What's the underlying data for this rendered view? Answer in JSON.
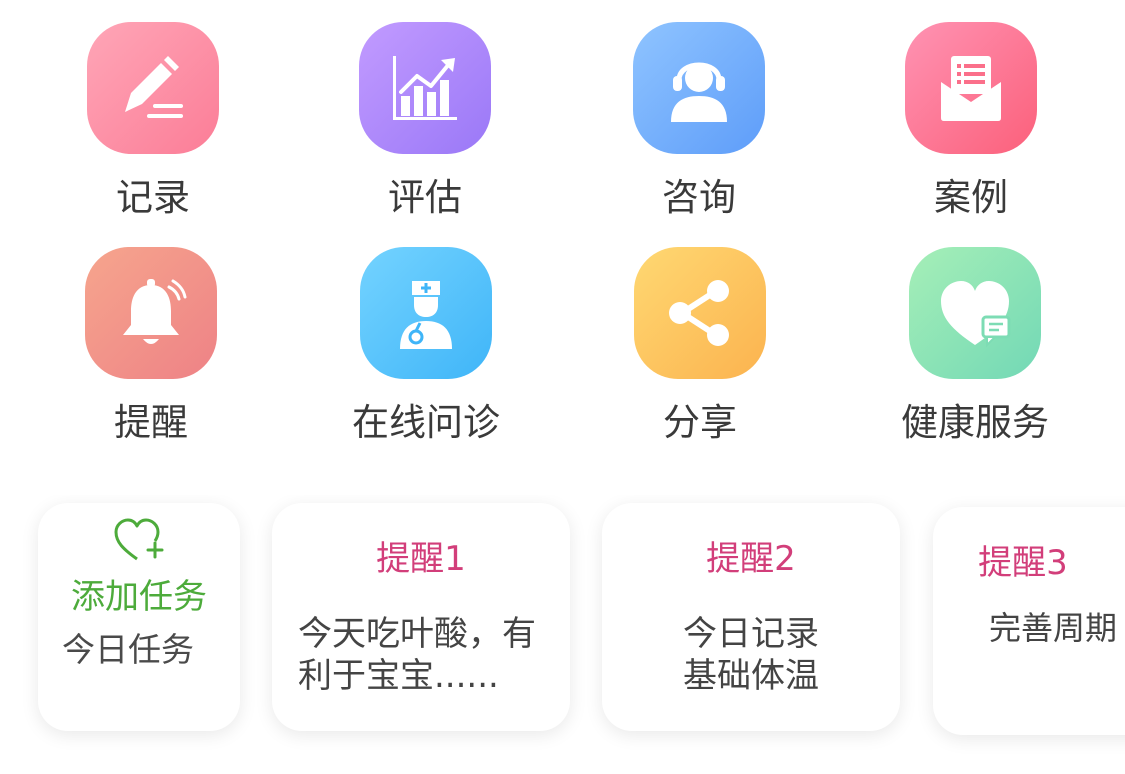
{
  "colors": {
    "label": "#3a3a3a",
    "reminder_title": "#d23e7a",
    "add_task": "#4dab3b",
    "card_text": "#444444"
  },
  "features": [
    {
      "label": "记录",
      "icon": "pencil-icon"
    },
    {
      "label": "评估",
      "icon": "bar-chart-icon"
    },
    {
      "label": "咨询",
      "icon": "headset-agent-icon"
    },
    {
      "label": "案例",
      "icon": "mail-envelope-icon"
    },
    {
      "label": "提醒",
      "icon": "bell-icon"
    },
    {
      "label": "在线问诊",
      "icon": "doctor-icon"
    },
    {
      "label": "分享",
      "icon": "share-icon"
    },
    {
      "label": "健康服务",
      "icon": "heart-chat-icon"
    }
  ],
  "tasks": {
    "add_card": {
      "icon": "heart-plus-icon",
      "title": "添加任务",
      "subtitle": "今日任务"
    },
    "reminders": [
      {
        "title": "提醒1",
        "body": "今天吃叶酸，有\n利于宝宝......"
      },
      {
        "title": "提醒2",
        "body": "今日记录\n基础体温"
      },
      {
        "title": "提醒3",
        "body": "完善周期"
      }
    ]
  }
}
